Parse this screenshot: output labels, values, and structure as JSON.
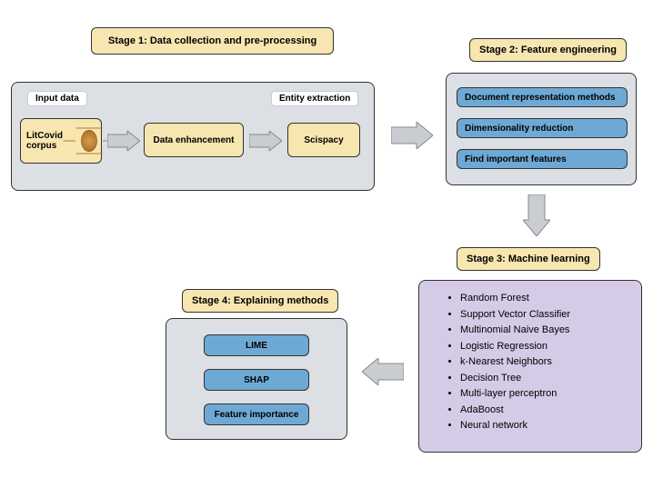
{
  "stage1": {
    "title": "Stage 1: Data collection and pre-processing",
    "input_label": "Input data",
    "entity_label": "Entity extraction",
    "litcovid": "LitCovid corpus",
    "data_enh": "Data enhancement",
    "scispacy": "Scispacy"
  },
  "stage2": {
    "title": "Stage 2: Feature engineering",
    "item1": "Document representation methods",
    "item2": "Dimensionality reduction",
    "item3": "Find important features"
  },
  "stage3": {
    "title": "Stage 3: Machine learning",
    "algorithms": [
      "Random Forest",
      "Support Vector Classifier",
      "Multinomial Naive Bayes",
      "Logistic Regression",
      "k-Nearest Neighbors",
      "Decision Tree",
      "Multi-layer perceptron",
      "AdaBoost",
      "Neural network"
    ]
  },
  "stage4": {
    "title": "Stage 4: Explaining methods",
    "item1": "LIME",
    "item2": "SHAP",
    "item3": "Feature importance"
  }
}
